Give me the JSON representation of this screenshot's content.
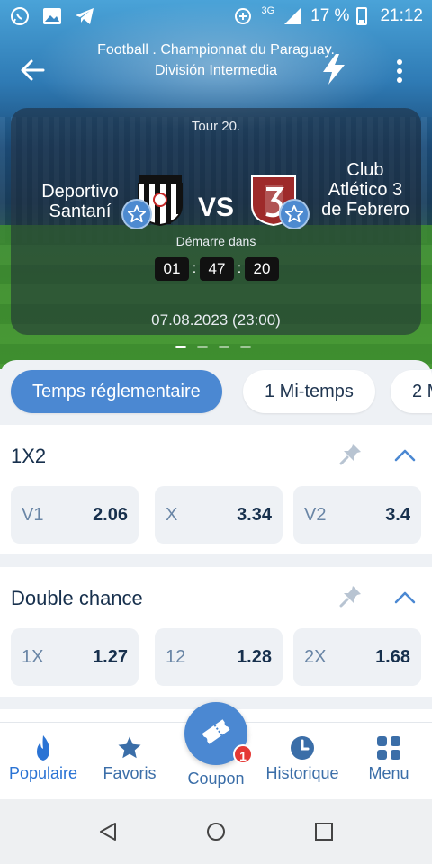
{
  "status_bar": {
    "network": "3G",
    "battery_pct": "17 %",
    "time": "21:12"
  },
  "header": {
    "league": "Football . Championnat du Paraguay. División Intermedia"
  },
  "match": {
    "round": "Tour 20.",
    "home_team": "Deportivo Santaní",
    "away_team": "Club Atlético 3 de Febrero",
    "vs_label": "VS",
    "starts_label": "Démarre dans",
    "countdown": {
      "hours": "01",
      "minutes": "47",
      "seconds": "20"
    },
    "date": "07.08.2023 (23:00)"
  },
  "carousel": {
    "pages": 4,
    "active": 0
  },
  "period_tabs": [
    {
      "label": "Temps réglementaire",
      "active": true
    },
    {
      "label": "1 Mi-temps",
      "active": false
    },
    {
      "label": "2 M",
      "active": false
    }
  ],
  "markets": [
    {
      "title": "1X2",
      "odds": [
        {
          "label": "V1",
          "value": "2.06"
        },
        {
          "label": "X",
          "value": "3.34"
        },
        {
          "label": "V2",
          "value": "3.4"
        }
      ]
    },
    {
      "title": "Double chance",
      "odds": [
        {
          "label": "1X",
          "value": "1.27"
        },
        {
          "label": "12",
          "value": "1.28"
        },
        {
          "label": "2X",
          "value": "1.68"
        }
      ]
    }
  ],
  "bottom_nav": {
    "popular": "Populaire",
    "favorites": "Favoris",
    "coupon": "Coupon",
    "coupon_badge": "1",
    "history": "Historique",
    "menu": "Menu"
  },
  "colors": {
    "accent": "#4b88d2",
    "text_dark": "#17304d",
    "badge": "#e53935"
  }
}
